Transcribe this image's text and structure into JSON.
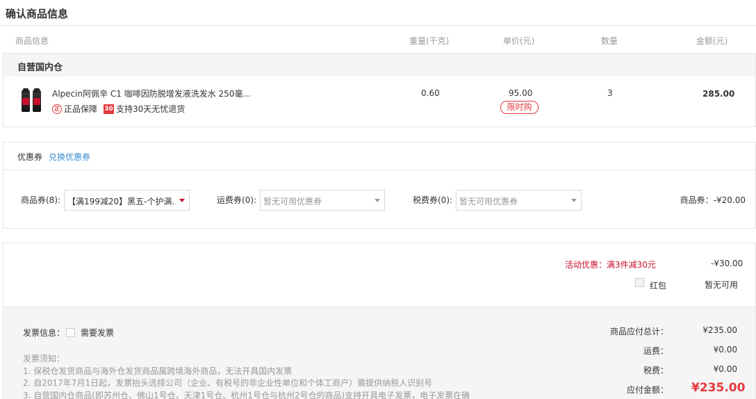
{
  "page": {
    "title": "确认商品信息"
  },
  "columns": {
    "product": "商品信息",
    "weight": "重量(千克)",
    "unit_price": "单价(元)",
    "quantity": "数量",
    "amount": "金额(元)"
  },
  "store": {
    "name": "自营国内仓"
  },
  "product": {
    "name": "Alpecin阿佩辛 C1 咖啡因防脱增发液洗发水 250毫...",
    "tag_genuine": "正品保障",
    "tag_genuine_icon": "正",
    "tag_return": "支持30天无忧退货",
    "tag_return_icon": "30",
    "weight": "0.60",
    "unit_price": "95.00",
    "badge": "限时购",
    "quantity": "3",
    "amount": "285.00"
  },
  "coupons": {
    "heading": "优惠券",
    "exchange_link": "兑换优惠券",
    "goods_label": "商品券(8):",
    "goods_selected": "【满199减20】黑五-个护满...",
    "shipping_label": "运费券(0):",
    "shipping_placeholder": "暂无可用优惠券",
    "tax_label": "税费券(0):",
    "tax_placeholder": "暂无可用优惠券",
    "goods_discount": "商品券：-¥20.00"
  },
  "promotion": {
    "label": "活动优惠：满3件减30元",
    "value": "-¥30.00",
    "red_packet_label": "红包",
    "red_packet_value": "暂无可用"
  },
  "invoice": {
    "label": "发票信息：",
    "need_label": "需要发票",
    "notes_title": "发票须知：",
    "notes": [
      "1. 保税仓发货商品与海外仓发货商品属跨境海外商品，无法开具国内发票",
      "2. 自2017年7月1日起，发票抬头选择公司（企业、有税号的非企业性单位和个体工商户）需提供纳税人识别号",
      "3. 自营国内仓商品(即苏州仓、佛山1号仓、天津1号仓、杭州1号仓与杭州2号仓的商品)支持开具电子发票，电子发票在确"
    ]
  },
  "totals": {
    "goods_total_label": "商品应付总计：",
    "goods_total": "¥235.00",
    "shipping_label": "运费：",
    "shipping": "¥0.00",
    "tax_label": "税费：",
    "tax": "¥0.00",
    "pay_label": "应付金额：",
    "pay": "¥235.00"
  },
  "colors": {
    "accent": "#e4393c",
    "promo": "#c8102e",
    "link": "#3c8dd1"
  }
}
